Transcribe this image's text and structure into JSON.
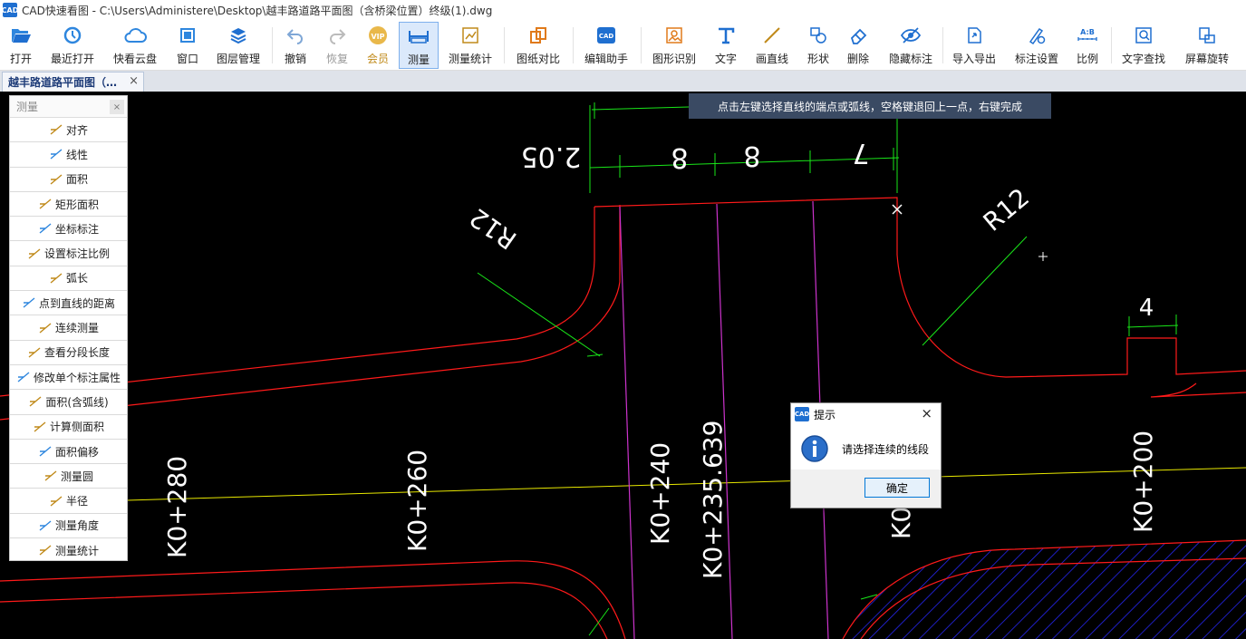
{
  "window": {
    "logo_text": "CAD",
    "title": "CAD快速看图 - C:\\Users\\Administere\\Desktop\\越丰路道路平面图（含桥梁位置）终级(1).dwg"
  },
  "toolbar": {
    "open": {
      "label": "打开",
      "icon": "open-folder-icon"
    },
    "recent": {
      "label": "最近打开",
      "icon": "clock-icon"
    },
    "cloud": {
      "label": "快看云盘",
      "icon": "cloud-icon"
    },
    "window": {
      "label": "窗口",
      "icon": "window-icon"
    },
    "layers": {
      "label": "图层管理",
      "icon": "layers-icon"
    },
    "undo": {
      "label": "撤销",
      "icon": "undo-icon"
    },
    "redo": {
      "label": "恢复",
      "icon": "redo-icon"
    },
    "vip": {
      "label": "会员",
      "icon": "vip-icon",
      "badge": "VIP"
    },
    "measure": {
      "label": "测量",
      "icon": "ruler-icon"
    },
    "measure_stats": {
      "label": "测量统计",
      "icon": "chart-icon"
    },
    "compare": {
      "label": "图纸对比",
      "icon": "compare-icon"
    },
    "edit_assistant": {
      "label": "编辑助手",
      "icon": "edit-assistant-icon"
    },
    "shape_recognize": {
      "label": "图形识别",
      "icon": "shape-recognize-icon"
    },
    "text": {
      "label": "文字",
      "icon": "text-icon"
    },
    "line": {
      "label": "画直线",
      "icon": "line-icon"
    },
    "shape": {
      "label": "形状",
      "icon": "shape-icon"
    },
    "delete": {
      "label": "删除",
      "icon": "eraser-icon"
    },
    "hide_annotation": {
      "label": "隐藏标注",
      "icon": "eye-hidden-icon"
    },
    "import_export": {
      "label": "导入导出",
      "icon": "import-export-icon"
    },
    "annotation_settings": {
      "label": "标注设置",
      "icon": "annotation-settings-icon"
    },
    "scale": {
      "label": "比例",
      "icon": "scale-icon",
      "badge": "A:B"
    },
    "find_text": {
      "label": "文字查找",
      "icon": "find-text-icon"
    },
    "rotate_screen": {
      "label": "屏幕旋转",
      "icon": "rotate-screen-icon"
    }
  },
  "tabs": [
    {
      "label": "越丰路道路平面图（…",
      "close": "×"
    }
  ],
  "measure_panel": {
    "title": "测量",
    "close": "×",
    "items": [
      {
        "label": "对齐",
        "icon": "align-measure-icon"
      },
      {
        "label": "线性",
        "icon": "linear-measure-icon"
      },
      {
        "label": "面积",
        "icon": "area-icon"
      },
      {
        "label": "矩形面积",
        "icon": "rect-area-icon"
      },
      {
        "label": "坐标标注",
        "icon": "coordinate-icon"
      },
      {
        "label": "设置标注比例",
        "icon": "scale-setting-icon"
      },
      {
        "label": "弧长",
        "icon": "arc-length-icon"
      },
      {
        "label": "点到直线的距离",
        "icon": "point-line-distance-icon"
      },
      {
        "label": "连续测量",
        "icon": "continuous-measure-icon"
      },
      {
        "label": "查看分段长度",
        "icon": "segment-length-icon"
      },
      {
        "label": "修改单个标注属性",
        "icon": "modify-annotation-icon"
      },
      {
        "label": "面积(含弧线)",
        "icon": "arc-area-icon"
      },
      {
        "label": "计算侧面积",
        "icon": "side-area-icon"
      },
      {
        "label": "面积偏移",
        "icon": "area-offset-icon"
      },
      {
        "label": "测量圆",
        "icon": "measure-circle-icon"
      },
      {
        "label": "半径",
        "icon": "radius-icon"
      },
      {
        "label": "测量角度",
        "icon": "angle-icon"
      },
      {
        "label": "测量统计",
        "icon": "measure-stats-icon"
      }
    ]
  },
  "hint": "点击左键选择直线的端点或弧线，空格键退回上一点，右键完成",
  "dialog": {
    "logo_text": "CAD",
    "title": "提示",
    "close": "×",
    "message": "请选择连续的线段",
    "ok": "确定",
    "icon": "info-icon"
  },
  "drawing": {
    "dimension_texts": [
      "2.05",
      "8",
      "8",
      "7",
      "4"
    ],
    "radius_labels": [
      "R12",
      "R12"
    ],
    "station_labels": [
      "K0+280",
      "K0+260",
      "K0+240",
      "K0+235.639",
      "K0",
      "K0+200"
    ],
    "colors": {
      "road": "#ff1a1a",
      "dimension": "#19e619",
      "centerline": "#e8e800",
      "bridge": "#cc33cc",
      "hatch": "#2828ff",
      "text": "#ffffff"
    }
  }
}
